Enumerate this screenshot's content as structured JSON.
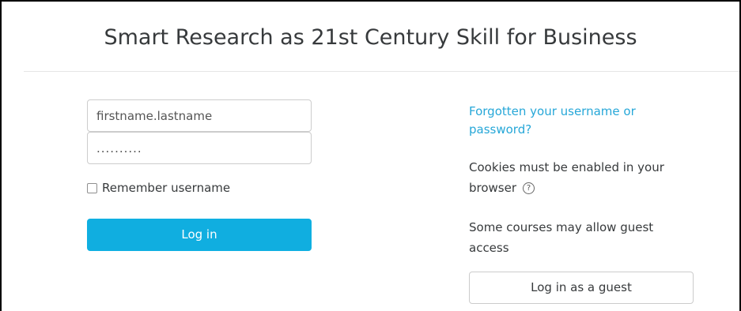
{
  "page": {
    "title": "Smart Research as 21st Century Skill for Business"
  },
  "login": {
    "username_value": "firstname.lastname",
    "password_value": "..........",
    "remember_label": "Remember username",
    "login_button_label": "Log in"
  },
  "help": {
    "forgot_link": "Forgotten your username or password?",
    "cookies_text": "Cookies must be enabled in your browser",
    "help_icon_glyph": "?",
    "guest_text": "Some courses may allow guest access",
    "guest_button_label": "Log in as a guest"
  },
  "colors": {
    "accent": "#10aee0",
    "link": "#26a7d8",
    "text": "#373a3c"
  }
}
